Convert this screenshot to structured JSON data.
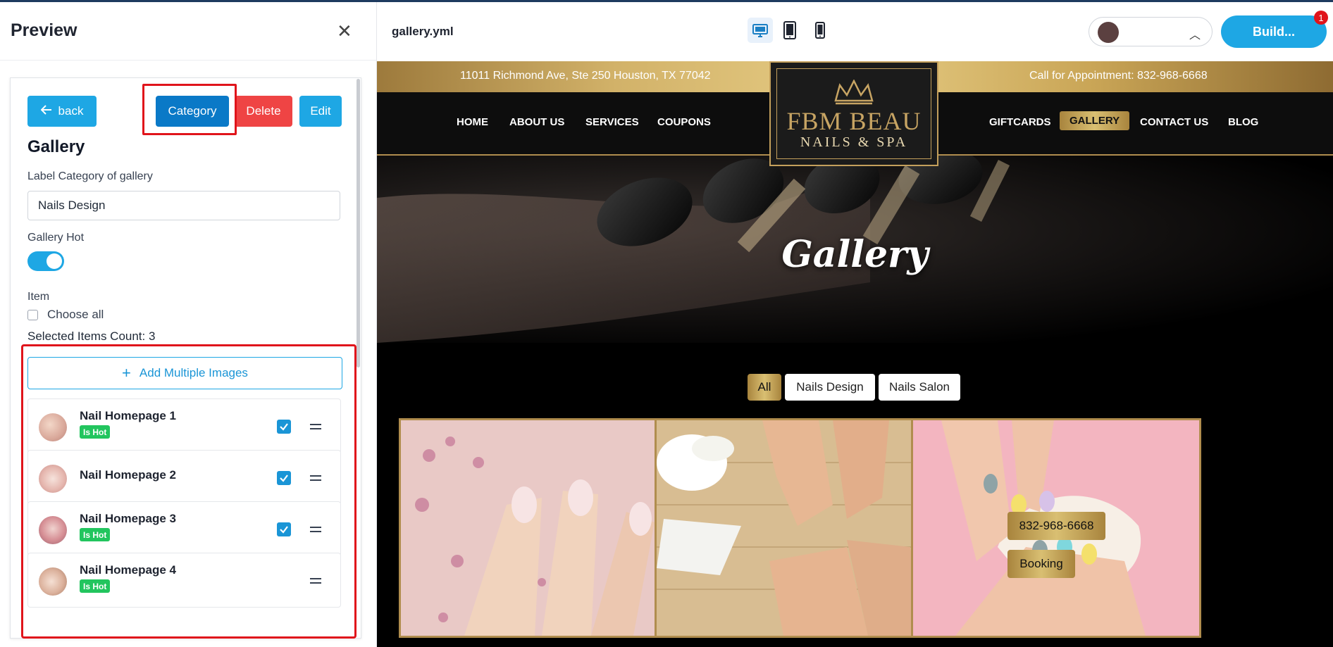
{
  "preview_panel": {
    "title": "Preview",
    "close_icon": "close-icon",
    "buttons": {
      "back": "back",
      "category": "Category",
      "delete": "Delete",
      "edit": "Edit"
    },
    "section_title": "Gallery",
    "label_category": "Label Category of gallery",
    "label_category_value": "Nails Design",
    "gallery_hot_label": "Gallery Hot",
    "gallery_hot_on": true,
    "item_label": "Item",
    "choose_all": "Choose all",
    "selected_count": "Selected Items Count: 3",
    "add_multiple": "Add Multiple Images",
    "items": [
      {
        "name": "Nail Homepage 1",
        "badge": "Is Hot",
        "checked": true
      },
      {
        "name": "Nail Homepage 2",
        "badge": "",
        "checked": true
      },
      {
        "name": "Nail Homepage 3",
        "badge": "Is Hot",
        "checked": true
      },
      {
        "name": "Nail Homepage 4",
        "badge": "Is Hot",
        "checked": false
      }
    ]
  },
  "editor_bar": {
    "file_name": "gallery.yml",
    "devices": [
      "desktop-icon",
      "tablet-icon",
      "mobile-icon"
    ],
    "active_device": "desktop",
    "build_label": "Build...",
    "notification_count": "1"
  },
  "site": {
    "address": "11011 Richmond Ave, Ste 250 Houston, TX 77042",
    "phone_line": "Call for Appointment: 832-968-6668",
    "logo_line1": "FBM BEAU",
    "logo_line2": "NAILS & SPA",
    "nav_left": [
      "HOME",
      "ABOUT US",
      "SERVICES",
      "COUPONS"
    ],
    "nav_right": [
      "GIFTCARDS",
      "GALLERY",
      "CONTACT US",
      "BLOG"
    ],
    "active_nav": "GALLERY",
    "hero_title": "Gallery",
    "filters": [
      "All",
      "Nails Design",
      "Nails Salon"
    ],
    "active_filter": "All",
    "float_phone": "832-968-6668",
    "float_booking": "Booking"
  },
  "colors": {
    "accent_blue": "#1ea7e4",
    "category_blue": "#0a79c7",
    "delete_red": "#ef4444",
    "highlight_red": "#e0141b",
    "hot_green": "#22c55e",
    "gold": "#c7a463"
  }
}
